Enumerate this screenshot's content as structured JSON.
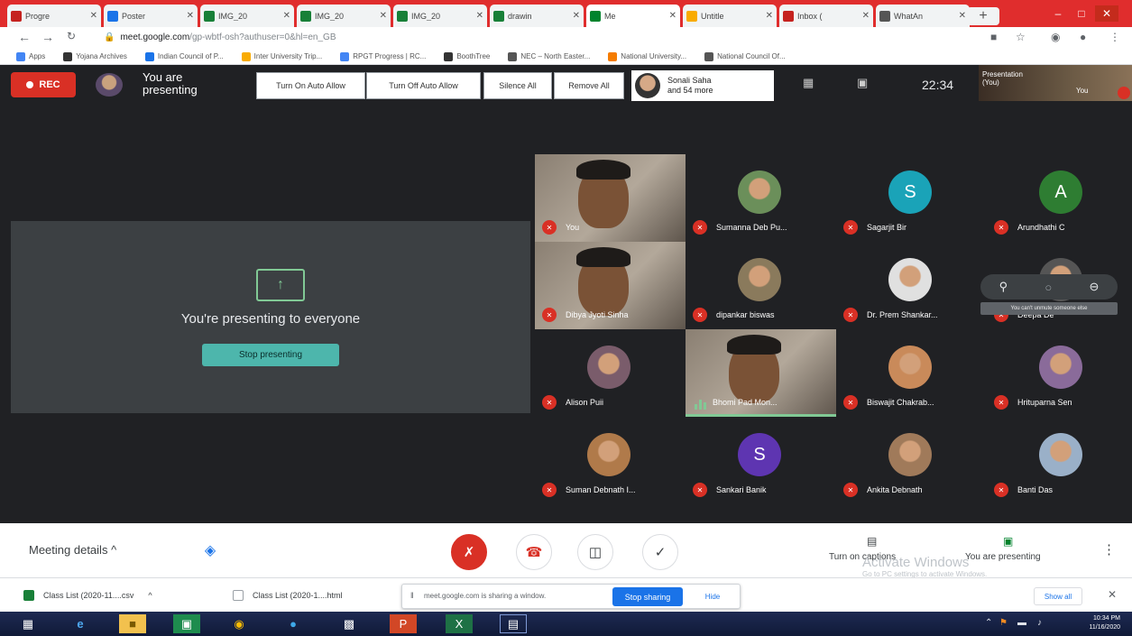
{
  "browser": {
    "tabs": [
      {
        "label": "Progre",
        "icon": "gmail-icon",
        "color": "#c5221f"
      },
      {
        "label": "Poster",
        "icon": "slides-icon",
        "color": "#1a73e8"
      },
      {
        "label": "IMG_20",
        "icon": "drive-icon",
        "color": "#188038"
      },
      {
        "label": "IMG_20",
        "icon": "drive-icon",
        "color": "#188038"
      },
      {
        "label": "IMG_20",
        "icon": "drive-icon",
        "color": "#188038"
      },
      {
        "label": "drawin",
        "icon": "drive-icon",
        "color": "#188038"
      },
      {
        "label": "Me",
        "icon": "meet-icon",
        "color": "#00832d"
      },
      {
        "label": "Untitle",
        "icon": "doc-icon",
        "color": "#f9ab00"
      },
      {
        "label": "Inbox (",
        "icon": "gmail-icon",
        "color": "#c5221f"
      },
      {
        "label": "WhatAn",
        "icon": "w-icon",
        "color": "#555555"
      }
    ],
    "url_host": "meet.google.com",
    "url_path": "/gp-wbtf-osh?authuser=0&hl=en_GB",
    "bookmarks": [
      {
        "label": "Apps",
        "color": "#4285f4"
      },
      {
        "label": "Yojana Archives",
        "color": "#333333"
      },
      {
        "label": "Indian Council of P...",
        "color": "#1a73e8"
      },
      {
        "label": "Inter University Trip...",
        "color": "#f9ab00"
      },
      {
        "label": "RPGT Progress | RC...",
        "color": "#4285f4"
      },
      {
        "label": "BoothTree",
        "color": "#333333"
      },
      {
        "label": "NEC – North Easter...",
        "color": "#555555"
      },
      {
        "label": "National University...",
        "color": "#f57c00"
      },
      {
        "label": "National Council Of...",
        "color": "#555555"
      }
    ]
  },
  "meet_top": {
    "rec_label": "REC",
    "presenter_line1": "You are",
    "presenter_line2": "presenting",
    "buttons": [
      "Turn On Auto Allow",
      "Turn Off Auto Allow",
      "Silence All",
      "Remove All"
    ],
    "people_line1": "Sonali Saha",
    "people_line2": "and 54 more",
    "clock": "22:34",
    "self_tile_label": "Presentation (You)",
    "self_tile_you": "You"
  },
  "presenting_panel": {
    "title": "You're presenting to everyone",
    "stop_button": "Stop presenting"
  },
  "participants": [
    {
      "name": "You",
      "kind": "video",
      "muted": true
    },
    {
      "name": "Sumanna Deb Pu...",
      "kind": "photo",
      "muted": true,
      "color": "#6b8f5a"
    },
    {
      "name": "Sagarjit Bir",
      "kind": "letter",
      "letter": "S",
      "muted": true,
      "color": "#1aa3b8"
    },
    {
      "name": "Arundhathi C",
      "kind": "letter",
      "letter": "A",
      "muted": true,
      "color": "#2e7d32"
    },
    {
      "name": "Dibya Jyoti Sinha",
      "kind": "video",
      "muted": true
    },
    {
      "name": "dipankar biswas",
      "kind": "photo",
      "muted": true,
      "color": "#8a7a5c"
    },
    {
      "name": "Dr. Prem Shankar...",
      "kind": "photo",
      "muted": true,
      "color": "#e0e0e0"
    },
    {
      "name": "Deepa De",
      "kind": "photo",
      "muted": true,
      "color": "#555555"
    },
    {
      "name": "Alison Puii",
      "kind": "photo",
      "muted": true,
      "color": "#7a5c6b"
    },
    {
      "name": "Bhomi Pad Mon...",
      "kind": "video",
      "muted": false,
      "speaking": true
    },
    {
      "name": "Biswajit Chakrab...",
      "kind": "photo",
      "muted": true,
      "color": "#c98a5a"
    },
    {
      "name": "Hrituparna Sen",
      "kind": "photo",
      "muted": true,
      "color": "#8a6b9a"
    },
    {
      "name": "Suman Debnath I...",
      "kind": "photo",
      "muted": true,
      "color": "#b07a4a"
    },
    {
      "name": "Sankari Banik",
      "kind": "letter",
      "letter": "S",
      "muted": true,
      "color": "#5e35b1"
    },
    {
      "name": "Ankita Debnath",
      "kind": "photo",
      "muted": true,
      "color": "#a07a5a"
    },
    {
      "name": "Banti Das",
      "kind": "photo",
      "muted": true,
      "color": "#9ab0c8"
    }
  ],
  "hover_tooltip": "You can't unmute someone else",
  "meet_bottom": {
    "details": "Meeting details",
    "captions_label": "Turn on captions",
    "presenting_label": "You are presenting",
    "watermark_line1": "Activate Windows",
    "watermark_line2": "Go to PC settings to activate Windows."
  },
  "downloads": [
    {
      "label": "Class List (2020-11....csv",
      "color": "#188038"
    },
    {
      "label": "Class List (2020-1....html",
      "color": "#9aa0a6"
    }
  ],
  "sharing": {
    "text": "meet.google.com is sharing a window.",
    "stop_button": "Stop sharing",
    "hide_button": "Hide"
  },
  "show_all": "Show all",
  "taskbar": {
    "time": "10:34 PM",
    "date": "11/16/2020"
  }
}
